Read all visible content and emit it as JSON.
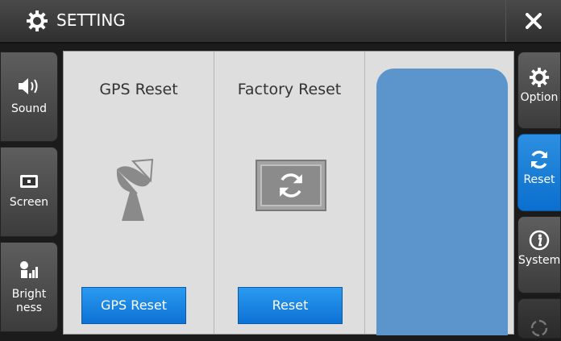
{
  "header": {
    "title": "SETTING",
    "gear_icon": "gear-icon",
    "close_icon": "close-icon"
  },
  "left_sidebar": {
    "items": [
      {
        "label": "Sound",
        "icon": "speaker-icon"
      },
      {
        "label": "Screen",
        "icon": "screen-icon"
      },
      {
        "label": "Brightness",
        "label_line1": "Bright",
        "label_line2": "ness",
        "icon": "brightness-icon"
      }
    ]
  },
  "right_sidebar": {
    "items": [
      {
        "label": "Option",
        "icon": "gear-icon"
      },
      {
        "label": "Reset",
        "icon": "refresh-icon",
        "active": true
      },
      {
        "label": "System",
        "icon": "info-icon"
      },
      {
        "label": "",
        "icon": "circle-icon",
        "disabled": true
      }
    ]
  },
  "main": {
    "gps": {
      "title": "GPS Reset",
      "button": "GPS Reset",
      "icon": "satellite-dish-icon"
    },
    "factory": {
      "title": "Factory Reset",
      "button": "Reset",
      "icon": "refresh-icon"
    }
  },
  "colors": {
    "accent": "#0d72d6",
    "panel": "#dedede",
    "blank": "#5b95cb"
  }
}
